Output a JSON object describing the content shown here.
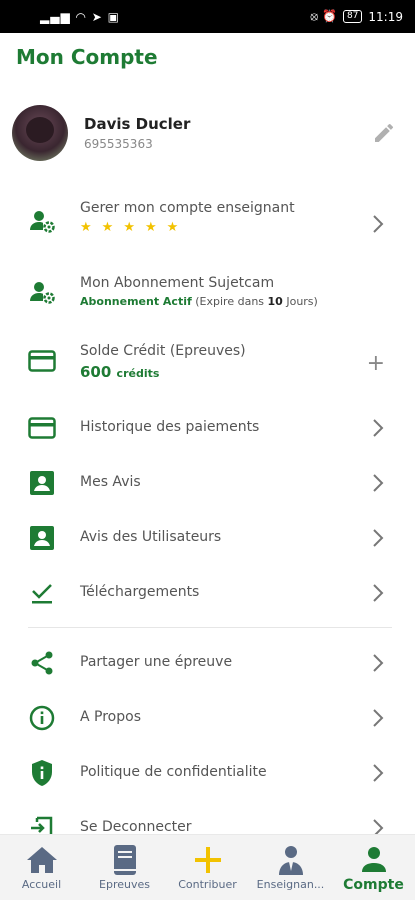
{
  "status_bar": {
    "signal": "▂▄▆ ◠ ➤ ▣",
    "indicators": "⦻ ⏰",
    "battery": "87",
    "time": "11:19"
  },
  "header": {
    "title": "Mon Compte"
  },
  "profile": {
    "name": "Davis Ducler",
    "phone": "695535363"
  },
  "menu": {
    "teacher": {
      "label": "Gerer mon compte enseignant",
      "stars": 5
    },
    "subscription": {
      "label": "Mon Abonnement Sujetcam",
      "status": "Abonnement Actif",
      "expires_prefix": "(Expire dans",
      "days": "10",
      "expires_suffix": "Jours)"
    },
    "credit": {
      "label": "Solde Crédit (Epreuves)",
      "value": "600",
      "unit": "crédits",
      "add": "+"
    },
    "payments": {
      "label": "Historique des paiements"
    },
    "my_reviews": {
      "label": "Mes Avis"
    },
    "user_reviews": {
      "label": "Avis des Utilisateurs"
    },
    "downloads": {
      "label": "Téléchargements"
    },
    "share": {
      "label": "Partager une épreuve"
    },
    "about": {
      "label": "A Propos"
    },
    "privacy": {
      "label": "Politique de confidentialite"
    },
    "logout": {
      "label": "Se Deconnecter"
    }
  },
  "bottom_nav": {
    "home": "Accueil",
    "exams": "Epreuves",
    "contribute": "Contribuer",
    "teachers": "Enseignan...",
    "account": "Compte"
  },
  "colors": {
    "primary": "#1e7b34",
    "star": "#f2c200",
    "muted": "#5a6a84"
  }
}
